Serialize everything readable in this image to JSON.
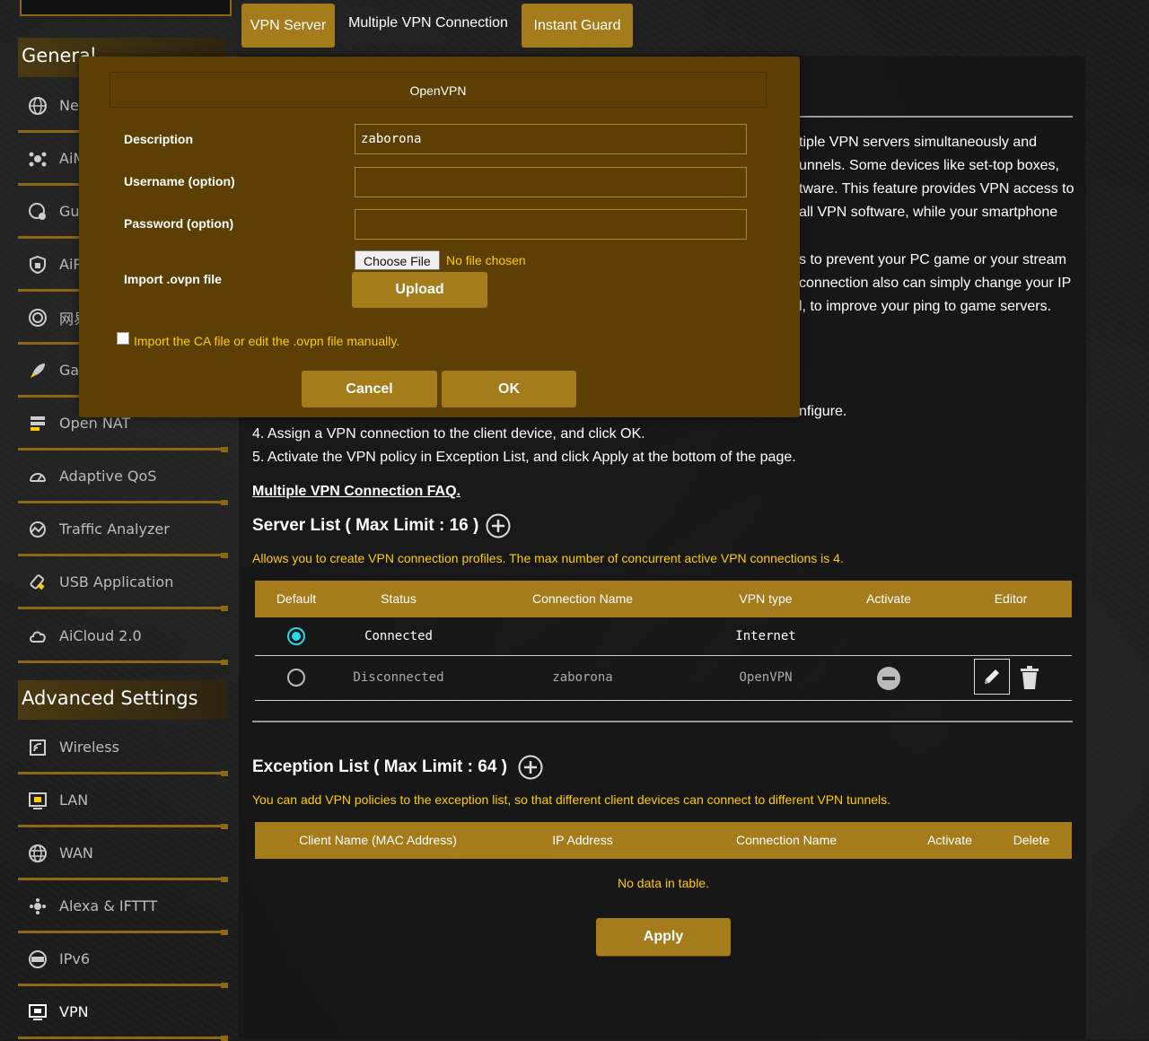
{
  "tabs": {
    "vpn_server": "VPN Server",
    "multiple_vpn": "Multiple VPN Connection",
    "instant_guard": "Instant Guard"
  },
  "sidebar": {
    "general_header": "General",
    "advanced_header": "Advanced Settings",
    "items": [
      {
        "label": "Ne",
        "icon": "globe-icon"
      },
      {
        "label": "AiM",
        "icon": "mesh-icon"
      },
      {
        "label": "Gu",
        "icon": "guest-network-icon"
      },
      {
        "label": "AiP",
        "icon": "shield-icon"
      },
      {
        "label": "网易",
        "icon": "target-icon"
      },
      {
        "label": "Ga",
        "icon": "rocket-icon"
      },
      {
        "label": "Open NAT",
        "icon": "open-nat-icon"
      },
      {
        "label": "Adaptive QoS",
        "icon": "gauge-icon"
      },
      {
        "label": "Traffic Analyzer",
        "icon": "traffic-icon"
      },
      {
        "label": "USB Application",
        "icon": "usb-icon"
      },
      {
        "label": "AiCloud 2.0",
        "icon": "cloud-icon"
      }
    ],
    "advanced_items": [
      {
        "label": "Wireless",
        "icon": "wireless-icon"
      },
      {
        "label": "LAN",
        "icon": "lan-icon"
      },
      {
        "label": "WAN",
        "icon": "wan-icon"
      },
      {
        "label": "Alexa & IFTTT",
        "icon": "alexa-icon"
      },
      {
        "label": "IPv6",
        "icon": "ipv6-icon"
      },
      {
        "label": "VPN",
        "icon": "vpn-icon"
      }
    ]
  },
  "description": {
    "lines": [
      "tiple VPN servers simultaneously and",
      "unnels. Some devices like set-top boxes,",
      "tware. This feature provides VPN access to",
      "all VPN software, while your smartphone",
      "s to prevent your PC game or your stream",
      "connection also can simply change your IP",
      "l, to improve your ping to game servers."
    ],
    "step3_tail": "nfigure.",
    "step4": "4. Assign a VPN connection to the client device, and click OK.",
    "step5": "5. Activate the VPN policy in Exception List, and click Apply at the bottom of the page.",
    "faq": "Multiple VPN Connection FAQ."
  },
  "server_list": {
    "title": "Server List ( Max Limit : 16 )",
    "note": "Allows you to create VPN connection profiles. The max number of concurrent active VPN connections is 4.",
    "columns": [
      "Default",
      "Status",
      "Connection Name",
      "VPN type",
      "Activate",
      "Editor"
    ],
    "rows": [
      {
        "default": true,
        "status": "Connected",
        "name": "",
        "type": "Internet"
      },
      {
        "default": false,
        "status": "Disconnected",
        "name": "zaborona",
        "type": "OpenVPN"
      }
    ]
  },
  "exception_list": {
    "title": "Exception List ( Max Limit : 64 )",
    "note": "You can add VPN policies to the exception list, so that different client devices can connect to different VPN tunnels.",
    "columns": [
      "Client Name (MAC Address)",
      "IP Address",
      "Connection Name",
      "Activate",
      "Delete"
    ],
    "empty": "No data in table."
  },
  "apply_label": "Apply",
  "modal": {
    "title": "OpenVPN",
    "description_label": "Description",
    "description_value": "zaborona",
    "username_label": "Username (option)",
    "username_value": "",
    "password_label": "Password (option)",
    "password_value": "",
    "import_label": "Import .ovpn file",
    "choose_file": "Choose File",
    "no_file": "No file chosen",
    "upload": "Upload",
    "manual_label": "Import the CA file or edit the .ovpn file manually.",
    "cancel": "Cancel",
    "ok": "OK"
  },
  "colors": {
    "accent": "#a47c1b",
    "modal_bg": "#5c3f05",
    "note_yellow": "#ffcc00",
    "radio_on": "#29d8e8"
  }
}
